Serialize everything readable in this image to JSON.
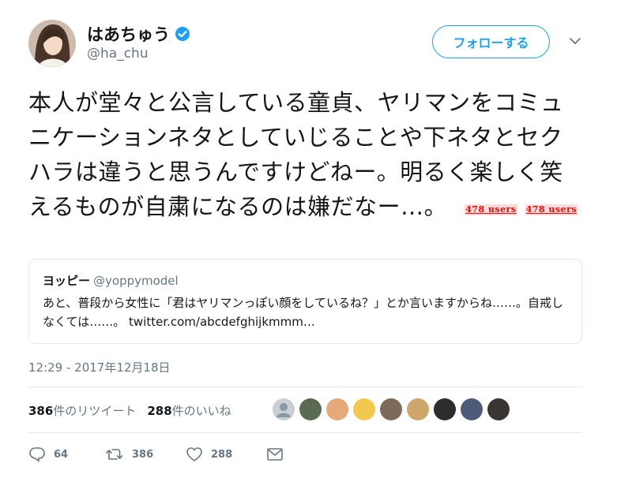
{
  "user": {
    "display_name": "はあちゅう",
    "screen_name": "@ha_chu",
    "avatar_icon": "user-avatar",
    "verified_icon": "verified-badge-icon"
  },
  "follow_button": {
    "label": "フォローする"
  },
  "menu_icon": "chevron-down-icon",
  "tweet": {
    "text": "本人が堂々と公言している童貞、ヤリマンをコミュニケーションネタとしていじることや下ネタとセクハラは違うと思うんですけどねー。明るく楽しく笑えるものが自粛になるのは嫌だなー…。",
    "hatena_badges": [
      "478 users",
      "478 users"
    ]
  },
  "quote": {
    "name": "ヨッピー",
    "handle": "@yoppymodel",
    "text": "あと、普段から女性に「君はヤリマンっぽい顔をしているね？」とか言いますからね……。自戒しなくては……。 twitter.com/abcdefghijkmmm…"
  },
  "timestamp": "12:29 - 2017年12月18日",
  "stats": {
    "retweets_count": "386",
    "retweets_label": "件のリツイート",
    "likes_count": "288",
    "likes_label": "件のいいね"
  },
  "liker_avatar_colors": [
    "#c9ced3",
    "#5a6b52",
    "#e7a87a",
    "#f2c94c",
    "#7d6a58",
    "#cfa66a",
    "#2d2d2d",
    "#4d5a78",
    "#3b3530"
  ],
  "actions": {
    "reply_count": "64",
    "retweet_count": "386",
    "like_count": "288"
  },
  "colors": {
    "accent": "#1da1f2",
    "text": "#14171a",
    "muted": "#657786",
    "border": "#e1e8ed",
    "hatena": "#ff0000"
  }
}
